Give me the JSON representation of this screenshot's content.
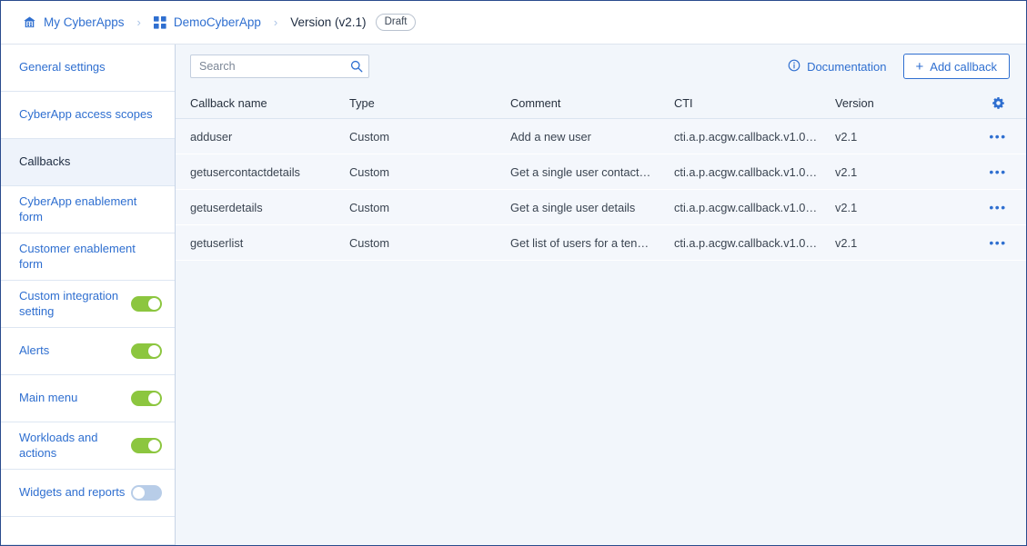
{
  "breadcrumb": {
    "items": [
      {
        "label": "My CyberApps",
        "icon": "home-icon",
        "current": false
      },
      {
        "label": "DemoCyberApp",
        "icon": "grid-icon",
        "current": false
      },
      {
        "label": "Version (v2.1)",
        "icon": "",
        "current": true
      }
    ],
    "separator": "›",
    "badge": "Draft"
  },
  "sidebar": {
    "items": [
      {
        "label": "General settings",
        "toggle": null,
        "active": false
      },
      {
        "label": "CyberApp access scopes",
        "toggle": null,
        "active": false
      },
      {
        "label": "Callbacks",
        "toggle": null,
        "active": true
      },
      {
        "label": "CyberApp enablement form",
        "toggle": null,
        "active": false
      },
      {
        "label": "Customer enablement form",
        "toggle": null,
        "active": false
      },
      {
        "label": "Custom integration setting",
        "toggle": "on",
        "active": false
      },
      {
        "label": "Alerts",
        "toggle": "on",
        "active": false
      },
      {
        "label": "Main menu",
        "toggle": "on",
        "active": false
      },
      {
        "label": "Workloads and actions",
        "toggle": "on",
        "active": false
      },
      {
        "label": "Widgets and reports",
        "toggle": "off",
        "active": false
      }
    ]
  },
  "toolbar": {
    "search_placeholder": "Search",
    "search_value": "",
    "search_icon": "search-icon",
    "documentation_label": "Documentation",
    "documentation_icon": "info-icon",
    "add_callback_label": "Add callback",
    "add_callback_icon": "plus-icon"
  },
  "table": {
    "settings_icon": "gear-icon",
    "row_menu_icon": "ellipsis-icon",
    "columns": [
      "Callback name",
      "Type",
      "Comment",
      "CTI",
      "Version"
    ],
    "rows": [
      {
        "name": "adduser",
        "type": "Custom",
        "comment": "Add a new user",
        "cti": "cti.a.p.acgw.callback.v1.0…",
        "version": "v2.1",
        "actions": "•••"
      },
      {
        "name": "getusercontactdetails",
        "type": "Custom",
        "comment": "Get a single user contact…",
        "cti": "cti.a.p.acgw.callback.v1.0…",
        "version": "v2.1",
        "actions": "•••"
      },
      {
        "name": "getuserdetails",
        "type": "Custom",
        "comment": "Get a single user details",
        "cti": "cti.a.p.acgw.callback.v1.0…",
        "version": "v2.1",
        "actions": "•••"
      },
      {
        "name": "getuserlist",
        "type": "Custom",
        "comment": "Get list of users for a ten…",
        "cti": "cti.a.p.acgw.callback.v1.0…",
        "version": "v2.1",
        "actions": "•••"
      }
    ]
  },
  "colors": {
    "accent_blue": "#2f6fd0",
    "toggle_on_green": "#8cc63f",
    "toggle_off_blue": "#b8cde8",
    "content_bg": "#f2f6fb",
    "row_bg": "#f4f7fc",
    "active_item_bg": "#eef3fb"
  }
}
